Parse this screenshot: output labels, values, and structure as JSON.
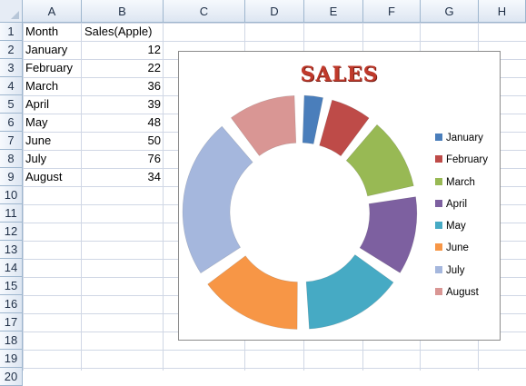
{
  "columns": [
    "A",
    "B",
    "C",
    "D",
    "E",
    "F",
    "G",
    "H"
  ],
  "rows": [
    "1",
    "2",
    "3",
    "4",
    "5",
    "6",
    "7",
    "8",
    "9",
    "10",
    "11",
    "12",
    "13",
    "14",
    "15",
    "16",
    "17",
    "18",
    "19",
    "20"
  ],
  "sheet": {
    "header_month": "Month",
    "header_sales": "Sales(Apple)"
  },
  "chart_data": {
    "type": "pie",
    "subtype": "exploded doughnut",
    "title": "SALES",
    "categories": [
      "January",
      "February",
      "March",
      "April",
      "May",
      "June",
      "July",
      "August"
    ],
    "values": [
      12,
      22,
      36,
      39,
      48,
      50,
      76,
      34
    ],
    "colors": [
      "#4a7ebb",
      "#be4b48",
      "#98b954",
      "#7d60a0",
      "#46aac4",
      "#f79646",
      "#a5b7dd",
      "#d99694"
    ],
    "legend": "right"
  }
}
